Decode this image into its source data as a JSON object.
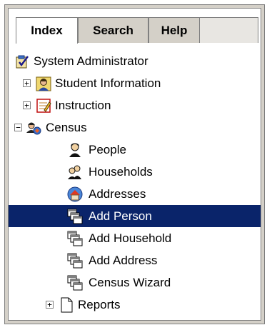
{
  "tabs": [
    {
      "label": "Index",
      "active": true
    },
    {
      "label": "Search",
      "active": false
    },
    {
      "label": "Help",
      "active": false
    }
  ],
  "tree": {
    "root": {
      "label": "System Administrator",
      "icon": "clipboard-check-icon"
    },
    "student": {
      "label": "Student Information",
      "icon": "student-icon",
      "toggle": "+"
    },
    "instruction": {
      "label": "Instruction",
      "icon": "notebook-icon",
      "toggle": "+"
    },
    "census": {
      "label": "Census",
      "icon": "census-group-icon",
      "toggle": "−"
    },
    "people": {
      "label": "People",
      "icon": "person-icon"
    },
    "households": {
      "label": "Households",
      "icon": "household-icon"
    },
    "addresses": {
      "label": "Addresses",
      "icon": "house-icon"
    },
    "add_person": {
      "label": "Add Person",
      "icon": "windows-stack-icon",
      "selected": true
    },
    "add_household": {
      "label": "Add Household",
      "icon": "windows-stack-icon"
    },
    "add_address": {
      "label": "Add Address",
      "icon": "windows-stack-icon"
    },
    "census_wizard": {
      "label": "Census Wizard",
      "icon": "windows-stack-icon"
    },
    "reports": {
      "label": "Reports",
      "icon": "document-icon",
      "toggle": "+"
    }
  },
  "colors": {
    "selection": "#0a246a",
    "panel": "#d4d0c8"
  }
}
